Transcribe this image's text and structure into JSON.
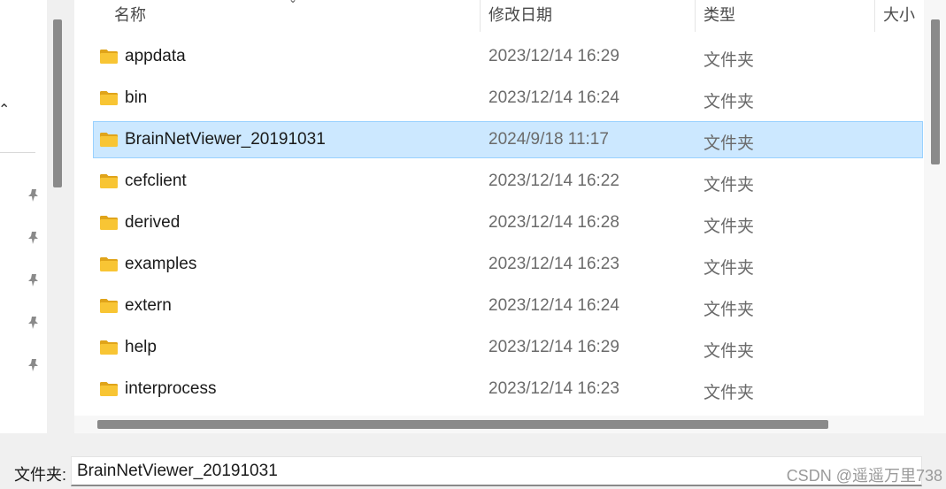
{
  "columns": {
    "name": "名称",
    "date_modified": "修改日期",
    "type": "类型",
    "size": "大小"
  },
  "files": [
    {
      "name": "appdata",
      "date": "2023/12/14 16:29",
      "type": "文件夹",
      "selected": false
    },
    {
      "name": "bin",
      "date": "2023/12/14 16:24",
      "type": "文件夹",
      "selected": false
    },
    {
      "name": "BrainNetViewer_20191031",
      "date": "2024/9/18 11:17",
      "type": "文件夹",
      "selected": true
    },
    {
      "name": "cefclient",
      "date": "2023/12/14 16:22",
      "type": "文件夹",
      "selected": false
    },
    {
      "name": "derived",
      "date": "2023/12/14 16:28",
      "type": "文件夹",
      "selected": false
    },
    {
      "name": "examples",
      "date": "2023/12/14 16:23",
      "type": "文件夹",
      "selected": false
    },
    {
      "name": "extern",
      "date": "2023/12/14 16:24",
      "type": "文件夹",
      "selected": false
    },
    {
      "name": "help",
      "date": "2023/12/14 16:29",
      "type": "文件夹",
      "selected": false
    },
    {
      "name": "interprocess",
      "date": "2023/12/14 16:23",
      "type": "文件夹",
      "selected": false
    }
  ],
  "footer": {
    "folder_label": "文件夹:",
    "folder_value": "BrainNetViewer_20191031"
  },
  "watermark": "CSDN @遥遥万里738",
  "colors": {
    "selection_bg": "#cce8ff",
    "selection_border": "#99d1ff",
    "folder_yellow": "#f8c534"
  }
}
